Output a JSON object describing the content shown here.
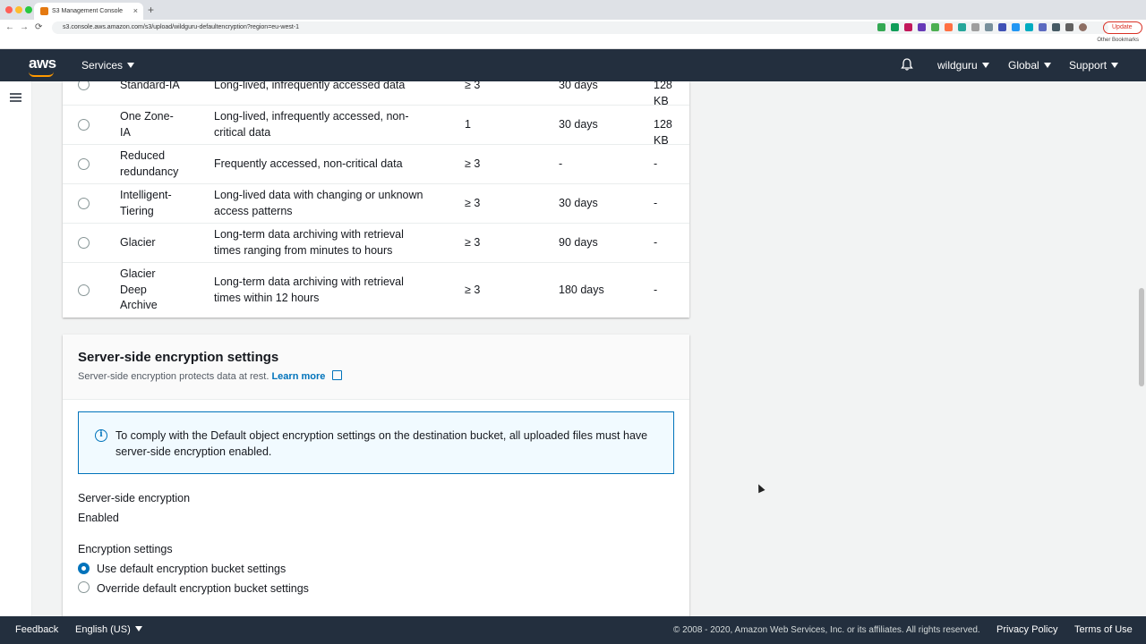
{
  "browser": {
    "tab_title": "S3 Management Console",
    "tab_close": "×",
    "new_tab": "+",
    "url": "s3.console.aws.amazon.com/s3/upload/wildguru-defaultencryption?region=eu-west-1",
    "update_label": "Update",
    "other_bookmarks": "Other Bookmarks",
    "nav": {
      "back": "←",
      "forward": "→",
      "reload": "⟳"
    }
  },
  "aws_nav": {
    "logo": "aws",
    "services": "Services",
    "account": "wildguru",
    "region": "Global",
    "support": "Support"
  },
  "storage_classes": {
    "rows": [
      {
        "name": "Standard-IA",
        "use_case": "Long-lived, infrequently accessed data",
        "az": "≥ 3",
        "min_duration": "30 days",
        "min_size": "128 KB"
      },
      {
        "name": "One Zone-IA",
        "use_case": "Long-lived, infrequently accessed, non-critical data",
        "az": "1",
        "min_duration": "30 days",
        "min_size": "128 KB"
      },
      {
        "name": "Reduced redundancy",
        "use_case": "Frequently accessed, non-critical data",
        "az": "≥ 3",
        "min_duration": "-",
        "min_size": "-"
      },
      {
        "name": "Intelligent-Tiering",
        "use_case": "Long-lived data with changing or unknown access patterns",
        "az": "≥ 3",
        "min_duration": "30 days",
        "min_size": "-"
      },
      {
        "name": "Glacier",
        "use_case": "Long-term data archiving with retrieval times ranging from minutes to hours",
        "az": "≥ 3",
        "min_duration": "90 days",
        "min_size": "-"
      },
      {
        "name": "Glacier Deep Archive",
        "use_case": "Long-term data archiving with retrieval times within 12 hours",
        "az": "≥ 3",
        "min_duration": "180 days",
        "min_size": "-"
      }
    ]
  },
  "encryption": {
    "title": "Server-side encryption settings",
    "description": "Server-side encryption protects data at rest.",
    "learn_more": "Learn more",
    "info": "To comply with the Default object encryption settings on the destination bucket, all uploaded files must have server-side encryption enabled.",
    "sse_label": "Server-side encryption",
    "sse_value": "Enabled",
    "settings_label": "Encryption settings",
    "option_default": "Use default encryption bucket settings",
    "option_override": "Override default encryption bucket settings",
    "selected": "default"
  },
  "footer": {
    "feedback": "Feedback",
    "language": "English (US)",
    "copyright": "© 2008 - 2020, Amazon Web Services, Inc. or its affiliates. All rights reserved.",
    "privacy": "Privacy Policy",
    "terms": "Terms of Use"
  },
  "colors": {
    "nav_bg": "#232f3e",
    "accent": "#0073bb",
    "brand": "#ff9900"
  }
}
